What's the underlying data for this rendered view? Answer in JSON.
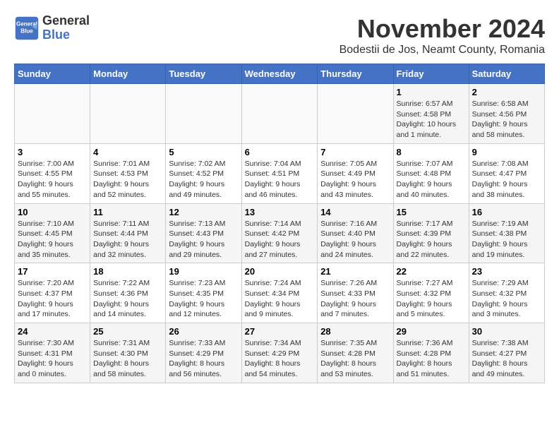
{
  "header": {
    "logo_line1": "General",
    "logo_line2": "Blue",
    "month": "November 2024",
    "location": "Bodestii de Jos, Neamt County, Romania"
  },
  "weekdays": [
    "Sunday",
    "Monday",
    "Tuesday",
    "Wednesday",
    "Thursday",
    "Friday",
    "Saturday"
  ],
  "weeks": [
    [
      {
        "day": "",
        "info": ""
      },
      {
        "day": "",
        "info": ""
      },
      {
        "day": "",
        "info": ""
      },
      {
        "day": "",
        "info": ""
      },
      {
        "day": "",
        "info": ""
      },
      {
        "day": "1",
        "info": "Sunrise: 6:57 AM\nSunset: 4:58 PM\nDaylight: 10 hours and 1 minute."
      },
      {
        "day": "2",
        "info": "Sunrise: 6:58 AM\nSunset: 4:56 PM\nDaylight: 9 hours and 58 minutes."
      }
    ],
    [
      {
        "day": "3",
        "info": "Sunrise: 7:00 AM\nSunset: 4:55 PM\nDaylight: 9 hours and 55 minutes."
      },
      {
        "day": "4",
        "info": "Sunrise: 7:01 AM\nSunset: 4:53 PM\nDaylight: 9 hours and 52 minutes."
      },
      {
        "day": "5",
        "info": "Sunrise: 7:02 AM\nSunset: 4:52 PM\nDaylight: 9 hours and 49 minutes."
      },
      {
        "day": "6",
        "info": "Sunrise: 7:04 AM\nSunset: 4:51 PM\nDaylight: 9 hours and 46 minutes."
      },
      {
        "day": "7",
        "info": "Sunrise: 7:05 AM\nSunset: 4:49 PM\nDaylight: 9 hours and 43 minutes."
      },
      {
        "day": "8",
        "info": "Sunrise: 7:07 AM\nSunset: 4:48 PM\nDaylight: 9 hours and 40 minutes."
      },
      {
        "day": "9",
        "info": "Sunrise: 7:08 AM\nSunset: 4:47 PM\nDaylight: 9 hours and 38 minutes."
      }
    ],
    [
      {
        "day": "10",
        "info": "Sunrise: 7:10 AM\nSunset: 4:45 PM\nDaylight: 9 hours and 35 minutes."
      },
      {
        "day": "11",
        "info": "Sunrise: 7:11 AM\nSunset: 4:44 PM\nDaylight: 9 hours and 32 minutes."
      },
      {
        "day": "12",
        "info": "Sunrise: 7:13 AM\nSunset: 4:43 PM\nDaylight: 9 hours and 29 minutes."
      },
      {
        "day": "13",
        "info": "Sunrise: 7:14 AM\nSunset: 4:42 PM\nDaylight: 9 hours and 27 minutes."
      },
      {
        "day": "14",
        "info": "Sunrise: 7:16 AM\nSunset: 4:40 PM\nDaylight: 9 hours and 24 minutes."
      },
      {
        "day": "15",
        "info": "Sunrise: 7:17 AM\nSunset: 4:39 PM\nDaylight: 9 hours and 22 minutes."
      },
      {
        "day": "16",
        "info": "Sunrise: 7:19 AM\nSunset: 4:38 PM\nDaylight: 9 hours and 19 minutes."
      }
    ],
    [
      {
        "day": "17",
        "info": "Sunrise: 7:20 AM\nSunset: 4:37 PM\nDaylight: 9 hours and 17 minutes."
      },
      {
        "day": "18",
        "info": "Sunrise: 7:22 AM\nSunset: 4:36 PM\nDaylight: 9 hours and 14 minutes."
      },
      {
        "day": "19",
        "info": "Sunrise: 7:23 AM\nSunset: 4:35 PM\nDaylight: 9 hours and 12 minutes."
      },
      {
        "day": "20",
        "info": "Sunrise: 7:24 AM\nSunset: 4:34 PM\nDaylight: 9 hours and 9 minutes."
      },
      {
        "day": "21",
        "info": "Sunrise: 7:26 AM\nSunset: 4:33 PM\nDaylight: 9 hours and 7 minutes."
      },
      {
        "day": "22",
        "info": "Sunrise: 7:27 AM\nSunset: 4:32 PM\nDaylight: 9 hours and 5 minutes."
      },
      {
        "day": "23",
        "info": "Sunrise: 7:29 AM\nSunset: 4:32 PM\nDaylight: 9 hours and 3 minutes."
      }
    ],
    [
      {
        "day": "24",
        "info": "Sunrise: 7:30 AM\nSunset: 4:31 PM\nDaylight: 9 hours and 0 minutes."
      },
      {
        "day": "25",
        "info": "Sunrise: 7:31 AM\nSunset: 4:30 PM\nDaylight: 8 hours and 58 minutes."
      },
      {
        "day": "26",
        "info": "Sunrise: 7:33 AM\nSunset: 4:29 PM\nDaylight: 8 hours and 56 minutes."
      },
      {
        "day": "27",
        "info": "Sunrise: 7:34 AM\nSunset: 4:29 PM\nDaylight: 8 hours and 54 minutes."
      },
      {
        "day": "28",
        "info": "Sunrise: 7:35 AM\nSunset: 4:28 PM\nDaylight: 8 hours and 53 minutes."
      },
      {
        "day": "29",
        "info": "Sunrise: 7:36 AM\nSunset: 4:28 PM\nDaylight: 8 hours and 51 minutes."
      },
      {
        "day": "30",
        "info": "Sunrise: 7:38 AM\nSunset: 4:27 PM\nDaylight: 8 hours and 49 minutes."
      }
    ]
  ]
}
